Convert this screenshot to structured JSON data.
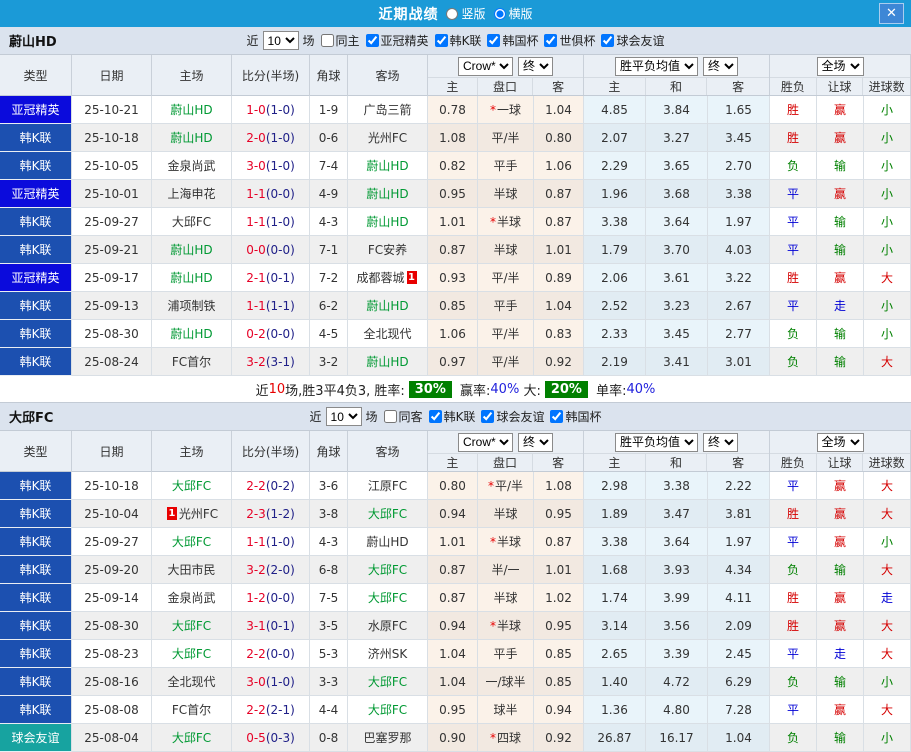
{
  "topbar": {
    "title": "近期战绩",
    "vertical_label": "竖版",
    "horizontal_label": "横版",
    "layout_selected": "横版",
    "close_glyph": "✕"
  },
  "filter_labels": {
    "near": "近",
    "matches": "场"
  },
  "table_header": {
    "type": "类型",
    "date": "日期",
    "home": "主场",
    "score": "比分(半场)",
    "corner": "角球",
    "away": "客场",
    "odds_select": "Crow*",
    "final_label": "终",
    "avg_select": "胜平负均值",
    "full_select": "全场",
    "sub_home": "主",
    "sub_handicap": "盘口",
    "sub_away": "客",
    "sub_avg_home": "主",
    "sub_avg_draw": "和",
    "sub_avg_away": "客",
    "sub_result": "胜负",
    "sub_handicap_result": "让球",
    "sub_goals": "进球数"
  },
  "colors": {
    "topbar_blue": "#1B9AD7",
    "league_acl_blue": "#0B0BDC",
    "league_kleague_blue": "#1C50B0",
    "league_friendly_teal": "#17A3A0",
    "score_red": "#E60026",
    "halftime_navy": "#202088",
    "focus_team_green": "#009933",
    "win_red": "#D50000",
    "draw_blue": "#0000D5",
    "lose_green": "#008000",
    "summary_badge_green": "#008000"
  },
  "sections": [
    {
      "team": "蔚山HD",
      "count": "10",
      "same_label": "同主",
      "same_checked": false,
      "leagues": [
        "亚冠精英",
        "韩K联",
        "韩国杯",
        "世俱杯",
        "球会友谊"
      ],
      "rows": [
        {
          "league": "亚冠精英",
          "lc": "acl",
          "date": "25-10-21",
          "home": "蔚山HD",
          "hf": true,
          "score": "1-0",
          "half": "(1-0)",
          "corner": "1-9",
          "away": "广岛三箭",
          "af": false,
          "o1": "0.78",
          "hcap": "*一球",
          "o2": "1.04",
          "a1": "4.85",
          "a2": "3.84",
          "a3": "1.65",
          "r1": [
            "胜",
            "r"
          ],
          "r2": [
            "赢",
            "r"
          ],
          "r3": [
            "小",
            "g"
          ]
        },
        {
          "league": "韩K联",
          "lc": "kl",
          "date": "25-10-18",
          "home": "蔚山HD",
          "hf": true,
          "score": "2-0",
          "half": "(1-0)",
          "corner": "0-6",
          "away": "光州FC",
          "af": false,
          "o1": "1.08",
          "hcap": "平/半",
          "o2": "0.80",
          "a1": "2.07",
          "a2": "3.27",
          "a3": "3.45",
          "r1": [
            "胜",
            "r"
          ],
          "r2": [
            "赢",
            "r"
          ],
          "r3": [
            "小",
            "g"
          ]
        },
        {
          "league": "韩K联",
          "lc": "kl",
          "date": "25-10-05",
          "home": "金泉尚武",
          "hf": false,
          "score": "3-0",
          "half": "(1-0)",
          "corner": "7-4",
          "away": "蔚山HD",
          "af": true,
          "o1": "0.82",
          "hcap": "平手",
          "o2": "1.06",
          "a1": "2.29",
          "a2": "3.65",
          "a3": "2.70",
          "r1": [
            "负",
            "g"
          ],
          "r2": [
            "输",
            "g"
          ],
          "r3": [
            "小",
            "g"
          ]
        },
        {
          "league": "亚冠精英",
          "lc": "acl",
          "date": "25-10-01",
          "home": "上海申花",
          "hf": false,
          "score": "1-1",
          "half": "(0-0)",
          "corner": "4-9",
          "away": "蔚山HD",
          "af": true,
          "o1": "0.95",
          "hcap": "半球",
          "o2": "0.87",
          "a1": "1.96",
          "a2": "3.68",
          "a3": "3.38",
          "r1": [
            "平",
            "b"
          ],
          "r2": [
            "赢",
            "r"
          ],
          "r3": [
            "小",
            "g"
          ]
        },
        {
          "league": "韩K联",
          "lc": "kl",
          "date": "25-09-27",
          "home": "大邱FC",
          "hf": false,
          "score": "1-1",
          "half": "(1-0)",
          "corner": "4-3",
          "away": "蔚山HD",
          "af": true,
          "o1": "1.01",
          "hcap": "*半球",
          "o2": "0.87",
          "a1": "3.38",
          "a2": "3.64",
          "a3": "1.97",
          "r1": [
            "平",
            "b"
          ],
          "r2": [
            "输",
            "g"
          ],
          "r3": [
            "小",
            "g"
          ]
        },
        {
          "league": "韩K联",
          "lc": "kl",
          "date": "25-09-21",
          "home": "蔚山HD",
          "hf": true,
          "score": "0-0",
          "half": "(0-0)",
          "corner": "7-1",
          "away": "FC安养",
          "af": false,
          "o1": "0.87",
          "hcap": "半球",
          "o2": "1.01",
          "a1": "1.79",
          "a2": "3.70",
          "a3": "4.03",
          "r1": [
            "平",
            "b"
          ],
          "r2": [
            "输",
            "g"
          ],
          "r3": [
            "小",
            "g"
          ]
        },
        {
          "league": "亚冠精英",
          "lc": "acl",
          "date": "25-09-17",
          "home": "蔚山HD",
          "hf": true,
          "score": "2-1",
          "half": "(0-1)",
          "corner": "7-2",
          "away": "成都蓉城",
          "af": false,
          "away_badge": "1",
          "o1": "0.93",
          "hcap": "平/半",
          "o2": "0.89",
          "a1": "2.06",
          "a2": "3.61",
          "a3": "3.22",
          "r1": [
            "胜",
            "r"
          ],
          "r2": [
            "赢",
            "r"
          ],
          "r3": [
            "大",
            "r"
          ]
        },
        {
          "league": "韩K联",
          "lc": "kl",
          "date": "25-09-13",
          "home": "浦项制铁",
          "hf": false,
          "score": "1-1",
          "half": "(1-1)",
          "corner": "6-2",
          "away": "蔚山HD",
          "af": true,
          "o1": "0.85",
          "hcap": "平手",
          "o2": "1.04",
          "a1": "2.52",
          "a2": "3.23",
          "a3": "2.67",
          "r1": [
            "平",
            "b"
          ],
          "r2": [
            "走",
            "b"
          ],
          "r3": [
            "小",
            "g"
          ]
        },
        {
          "league": "韩K联",
          "lc": "kl",
          "date": "25-08-30",
          "home": "蔚山HD",
          "hf": true,
          "score": "0-2",
          "half": "(0-0)",
          "corner": "4-5",
          "away": "全北现代",
          "af": false,
          "o1": "1.06",
          "hcap": "平/半",
          "o2": "0.83",
          "a1": "2.33",
          "a2": "3.45",
          "a3": "2.77",
          "r1": [
            "负",
            "g"
          ],
          "r2": [
            "输",
            "g"
          ],
          "r3": [
            "小",
            "g"
          ]
        },
        {
          "league": "韩K联",
          "lc": "kl",
          "date": "25-08-24",
          "home": "FC首尔",
          "hf": false,
          "score": "3-2",
          "half": "(3-1)",
          "corner": "3-2",
          "away": "蔚山HD",
          "af": true,
          "o1": "0.97",
          "hcap": "平/半",
          "o2": "0.92",
          "a1": "2.19",
          "a2": "3.41",
          "a3": "3.01",
          "r1": [
            "负",
            "g"
          ],
          "r2": [
            "输",
            "g"
          ],
          "r3": [
            "大",
            "r"
          ]
        }
      ],
      "summary": {
        "p1": "近",
        "p2": "10",
        "p3": "场,胜3平4负3, 胜率:",
        "badge1": "30%",
        "p4": " 赢率:",
        "pct1": "40%",
        "p5": " 大:",
        "badge2": "20%",
        "p6": " 单率:",
        "pct2": "40%"
      }
    },
    {
      "team": "大邱FC",
      "count": "10",
      "same_label": "同客",
      "same_checked": false,
      "leagues": [
        "韩K联",
        "球会友谊",
        "韩国杯"
      ],
      "rows": [
        {
          "league": "韩K联",
          "lc": "kl",
          "date": "25-10-18",
          "home": "大邱FC",
          "hf": true,
          "score": "2-2",
          "half": "(0-2)",
          "corner": "3-6",
          "away": "江原FC",
          "af": false,
          "o1": "0.80",
          "hcap": "*平/半",
          "o2": "1.08",
          "a1": "2.98",
          "a2": "3.38",
          "a3": "2.22",
          "r1": [
            "平",
            "b"
          ],
          "r2": [
            "赢",
            "r"
          ],
          "r3": [
            "大",
            "r"
          ]
        },
        {
          "league": "韩K联",
          "lc": "kl",
          "date": "25-10-04",
          "home": "光州FC",
          "hf": false,
          "home_badge": "1",
          "score": "2-3",
          "half": "(1-2)",
          "corner": "3-8",
          "away": "大邱FC",
          "af": true,
          "o1": "0.94",
          "hcap": "半球",
          "o2": "0.95",
          "a1": "1.89",
          "a2": "3.47",
          "a3": "3.81",
          "r1": [
            "胜",
            "r"
          ],
          "r2": [
            "赢",
            "r"
          ],
          "r3": [
            "大",
            "r"
          ]
        },
        {
          "league": "韩K联",
          "lc": "kl",
          "date": "25-09-27",
          "home": "大邱FC",
          "hf": true,
          "score": "1-1",
          "half": "(1-0)",
          "corner": "4-3",
          "away": "蔚山HD",
          "af": false,
          "o1": "1.01",
          "hcap": "*半球",
          "o2": "0.87",
          "a1": "3.38",
          "a2": "3.64",
          "a3": "1.97",
          "r1": [
            "平",
            "b"
          ],
          "r2": [
            "赢",
            "r"
          ],
          "r3": [
            "小",
            "g"
          ]
        },
        {
          "league": "韩K联",
          "lc": "kl",
          "date": "25-09-20",
          "home": "大田市民",
          "hf": false,
          "score": "3-2",
          "half": "(2-0)",
          "corner": "6-8",
          "away": "大邱FC",
          "af": true,
          "o1": "0.87",
          "hcap": "半/一",
          "o2": "1.01",
          "a1": "1.68",
          "a2": "3.93",
          "a3": "4.34",
          "r1": [
            "负",
            "g"
          ],
          "r2": [
            "输",
            "g"
          ],
          "r3": [
            "大",
            "r"
          ]
        },
        {
          "league": "韩K联",
          "lc": "kl",
          "date": "25-09-14",
          "home": "金泉尚武",
          "hf": false,
          "score": "1-2",
          "half": "(0-0)",
          "corner": "7-5",
          "away": "大邱FC",
          "af": true,
          "o1": "0.87",
          "hcap": "半球",
          "o2": "1.02",
          "a1": "1.74",
          "a2": "3.99",
          "a3": "4.11",
          "r1": [
            "胜",
            "r"
          ],
          "r2": [
            "赢",
            "r"
          ],
          "r3": [
            "走",
            "b"
          ]
        },
        {
          "league": "韩K联",
          "lc": "kl",
          "date": "25-08-30",
          "home": "大邱FC",
          "hf": true,
          "score": "3-1",
          "half": "(0-1)",
          "corner": "3-5",
          "away": "水原FC",
          "af": false,
          "o1": "0.94",
          "hcap": "*半球",
          "o2": "0.95",
          "a1": "3.14",
          "a2": "3.56",
          "a3": "2.09",
          "r1": [
            "胜",
            "r"
          ],
          "r2": [
            "赢",
            "r"
          ],
          "r3": [
            "大",
            "r"
          ]
        },
        {
          "league": "韩K联",
          "lc": "kl",
          "date": "25-08-23",
          "home": "大邱FC",
          "hf": true,
          "score": "2-2",
          "half": "(0-0)",
          "corner": "5-3",
          "away": "济州SK",
          "af": false,
          "o1": "1.04",
          "hcap": "平手",
          "o2": "0.85",
          "a1": "2.65",
          "a2": "3.39",
          "a3": "2.45",
          "r1": [
            "平",
            "b"
          ],
          "r2": [
            "走",
            "b"
          ],
          "r3": [
            "大",
            "r"
          ]
        },
        {
          "league": "韩K联",
          "lc": "kl",
          "date": "25-08-16",
          "home": "全北现代",
          "hf": false,
          "score": "3-0",
          "half": "(1-0)",
          "corner": "3-3",
          "away": "大邱FC",
          "af": true,
          "o1": "1.04",
          "hcap": "一/球半",
          "o2": "0.85",
          "a1": "1.40",
          "a2": "4.72",
          "a3": "6.29",
          "r1": [
            "负",
            "g"
          ],
          "r2": [
            "输",
            "g"
          ],
          "r3": [
            "小",
            "g"
          ]
        },
        {
          "league": "韩K联",
          "lc": "kl",
          "date": "25-08-08",
          "home": "FC首尔",
          "hf": false,
          "score": "2-2",
          "half": "(2-1)",
          "corner": "4-4",
          "away": "大邱FC",
          "af": true,
          "o1": "0.95",
          "hcap": "球半",
          "o2": "0.94",
          "a1": "1.36",
          "a2": "4.80",
          "a3": "7.28",
          "r1": [
            "平",
            "b"
          ],
          "r2": [
            "赢",
            "r"
          ],
          "r3": [
            "大",
            "r"
          ]
        },
        {
          "league": "球会友谊",
          "lc": "fr",
          "date": "25-08-04",
          "home": "大邱FC",
          "hf": true,
          "score": "0-5",
          "half": "(0-3)",
          "corner": "0-8",
          "away": "巴塞罗那",
          "af": false,
          "o1": "0.90",
          "hcap": "*四球",
          "o2": "0.92",
          "a1": "26.87",
          "a2": "16.17",
          "a3": "1.04",
          "r1": [
            "负",
            "g"
          ],
          "r2": [
            "输",
            "g"
          ],
          "r3": [
            "小",
            "g"
          ]
        }
      ],
      "summary": null
    }
  ]
}
